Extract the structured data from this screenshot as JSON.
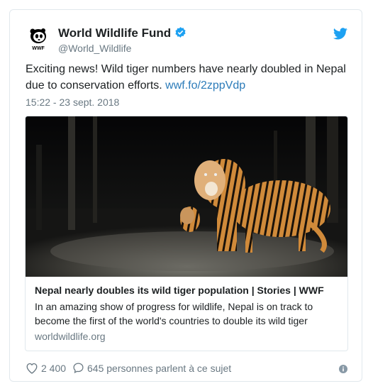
{
  "account": {
    "name": "World Wildlife Fund",
    "handle": "@World_Wildlife",
    "logo_text": "WWF"
  },
  "tweet": {
    "text": "Exciting news! Wild tiger numbers have nearly doubled in Nepal due to conservation efforts.",
    "link": "wwf.fo/2zppVdp",
    "timestamp": "15:22 - 23 sept. 2018"
  },
  "card": {
    "title": "Nepal nearly doubles its wild tiger population | Stories | WWF",
    "description": "In an amazing show of progress for wildlife, Nepal is on track to become the first of the world's countries to double its wild tiger",
    "domain": "worldwildlife.org",
    "image_icon": "tiger-photo"
  },
  "actions": {
    "likes": "2 400",
    "replies_text": "645 personnes parlent à ce sujet"
  },
  "colors": {
    "link": "#2b7bb9",
    "verified": "#1da1f2",
    "muted": "#697882",
    "border": "#e1e8ed"
  },
  "icons": [
    "wwf-panda-logo-icon",
    "verified-badge-icon",
    "twitter-bird-icon",
    "heart-icon",
    "comment-icon",
    "info-icon"
  ]
}
